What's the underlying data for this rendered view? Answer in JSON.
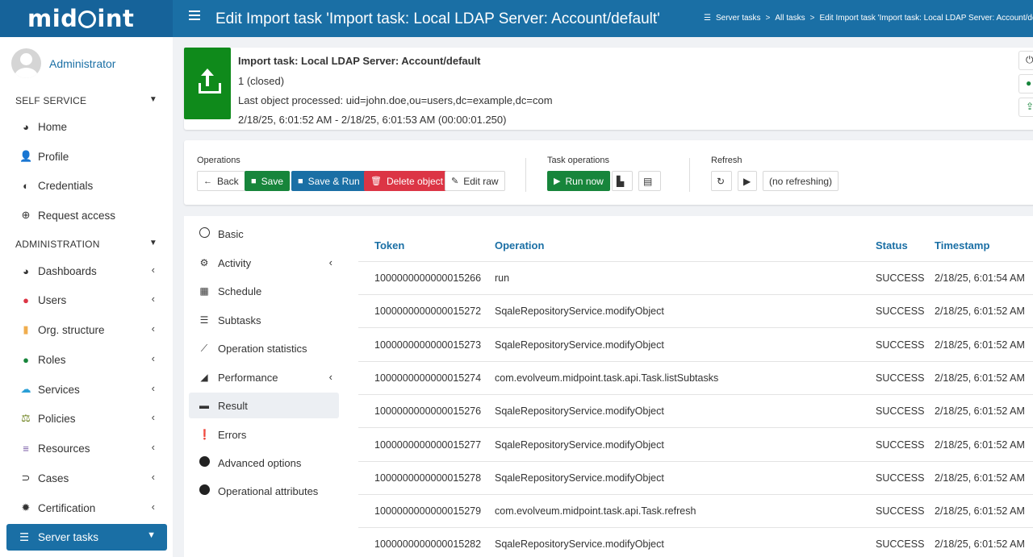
{
  "header": {
    "logo": "midPoint",
    "title": "Edit Import task 'Import task: Local LDAP Server: Account/default'",
    "breadcrumb": [
      "Server tasks",
      "All tasks",
      "Edit Import task 'Import task: Local LDAP Server: Account/default'"
    ]
  },
  "sidebar": {
    "user": "Administrator",
    "self_service": {
      "label": "SELF SERVICE",
      "items": [
        {
          "label": "Home",
          "icon": "dashboard-icon"
        },
        {
          "label": "Profile",
          "icon": "user-icon"
        },
        {
          "label": "Credentials",
          "icon": "shield-icon"
        },
        {
          "label": "Request access",
          "icon": "plus-circle-icon"
        }
      ]
    },
    "administration": {
      "label": "ADMINISTRATION",
      "items": [
        {
          "label": "Dashboards",
          "icon": "dashboard-icon"
        },
        {
          "label": "Users",
          "icon": "user-icon",
          "color": "#dc3545"
        },
        {
          "label": "Org. structure",
          "icon": "building-icon",
          "color": "#f0ad4e"
        },
        {
          "label": "Roles",
          "icon": "roles-icon",
          "color": "#17853b"
        },
        {
          "label": "Services",
          "icon": "cloud-icon",
          "color": "#2a9fd6"
        },
        {
          "label": "Policies",
          "icon": "balance-icon",
          "color": "#6b7f1a"
        },
        {
          "label": "Resources",
          "icon": "database-icon",
          "color": "#7b5ea7"
        },
        {
          "label": "Cases",
          "icon": "cases-icon"
        },
        {
          "label": "Certification",
          "icon": "certificate-icon"
        }
      ]
    },
    "active_item": "Server tasks"
  },
  "summary": {
    "title": "Import task: Local LDAP Server: Account/default",
    "status": "1 (closed)",
    "last_object": "Last object processed: uid=john.doe,ou=users,dc=example,dc=com",
    "time": "2/18/25, 6:01:52 AM - 2/18/25, 6:01:53 AM (00:00:01.250)",
    "icon_color": "#0f8a1b"
  },
  "operations": {
    "label": "Operations",
    "back": "Back",
    "save": "Save",
    "save_run": "Save & Run",
    "delete": "Delete object",
    "edit_raw": "Edit raw"
  },
  "task_operations": {
    "label": "Task operations",
    "run_now": "Run now"
  },
  "refresh": {
    "label": "Refresh",
    "status": "(no refreshing)"
  },
  "tabs": [
    {
      "label": "Basic"
    },
    {
      "label": "Activity"
    },
    {
      "label": "Schedule"
    },
    {
      "label": "Subtasks"
    },
    {
      "label": "Operation statistics"
    },
    {
      "label": "Performance"
    },
    {
      "label": "Result"
    },
    {
      "label": "Errors"
    },
    {
      "label": "Advanced options"
    },
    {
      "label": "Operational attributes"
    }
  ],
  "table": {
    "columns": [
      "Token",
      "Operation",
      "Status",
      "Timestamp"
    ],
    "rows": [
      [
        "1000000000000015266",
        "run",
        "SUCCESS",
        "2/18/25, 6:01:54 AM"
      ],
      [
        "1000000000000015272",
        "SqaleRepositoryService.modifyObject",
        "SUCCESS",
        "2/18/25, 6:01:52 AM"
      ],
      [
        "1000000000000015273",
        "SqaleRepositoryService.modifyObject",
        "SUCCESS",
        "2/18/25, 6:01:52 AM"
      ],
      [
        "1000000000000015274",
        "com.evolveum.midpoint.task.api.Task.listSubtasks",
        "SUCCESS",
        "2/18/25, 6:01:52 AM"
      ],
      [
        "1000000000000015276",
        "SqaleRepositoryService.modifyObject",
        "SUCCESS",
        "2/18/25, 6:01:52 AM"
      ],
      [
        "1000000000000015277",
        "SqaleRepositoryService.modifyObject",
        "SUCCESS",
        "2/18/25, 6:01:52 AM"
      ],
      [
        "1000000000000015278",
        "SqaleRepositoryService.modifyObject",
        "SUCCESS",
        "2/18/25, 6:01:52 AM"
      ],
      [
        "1000000000000015279",
        "com.evolveum.midpoint.task.api.Task.refresh",
        "SUCCESS",
        "2/18/25, 6:01:52 AM"
      ],
      [
        "1000000000000015282",
        "SqaleRepositoryService.modifyObject",
        "SUCCESS",
        "2/18/25, 6:01:52 AM"
      ]
    ]
  }
}
